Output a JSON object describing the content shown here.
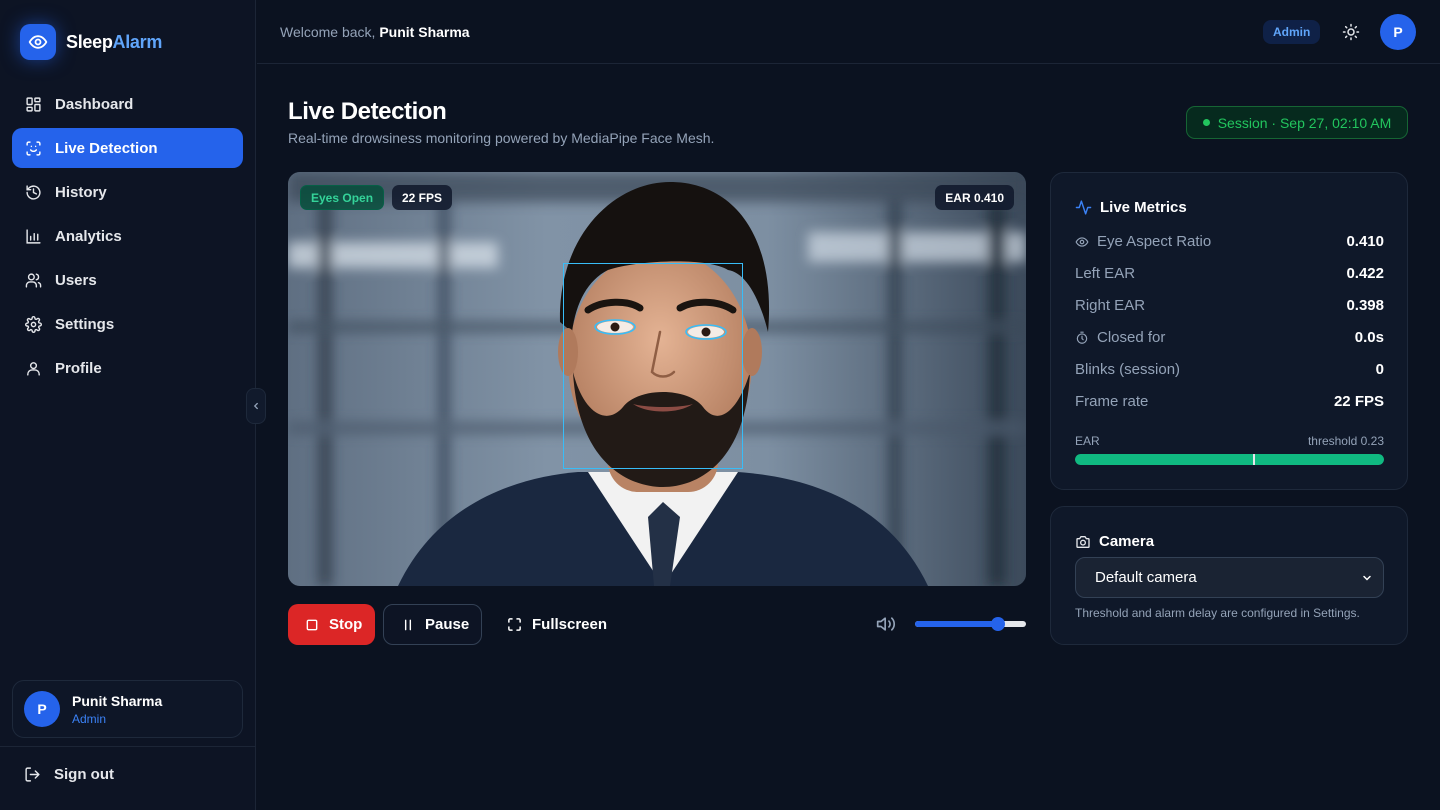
{
  "brand": {
    "name_part1": "Sleep",
    "name_part2": "Alarm"
  },
  "nav": [
    {
      "label": "Dashboard",
      "icon": "grid-icon"
    },
    {
      "label": "Live Detection",
      "icon": "scan-face-icon",
      "active": true
    },
    {
      "label": "History",
      "icon": "history-icon"
    },
    {
      "label": "Analytics",
      "icon": "bar-chart-icon"
    },
    {
      "label": "Users",
      "icon": "users-icon"
    },
    {
      "label": "Settings",
      "icon": "gear-icon"
    },
    {
      "label": "Profile",
      "icon": "user-icon"
    }
  ],
  "user": {
    "initial": "P",
    "name": "Punit Sharma",
    "role": "Admin"
  },
  "signout_label": "Sign out",
  "header": {
    "welcome_prefix": "Welcome back,",
    "welcome_name": "Punit Sharma",
    "role_badge": "Admin",
    "avatar_initial": "P"
  },
  "page": {
    "title": "Live Detection",
    "subtitle": "Real-time drowsiness monitoring powered by MediaPipe Face Mesh.",
    "session": "Session · Sep 27, 02:10 AM"
  },
  "video": {
    "eyes_tag": "Eyes Open",
    "fps_tag": "22 FPS",
    "ear_tag": "EAR 0.410"
  },
  "controls": {
    "stop_label": "Stop",
    "pause_label": "Pause",
    "fullscreen_label": "Fullscreen",
    "volume_level": 0.78
  },
  "metrics": {
    "title": "Live Metrics",
    "rows": [
      {
        "label": "Eye Aspect Ratio",
        "value": "0.410",
        "icon": "eye-icon"
      },
      {
        "label": "Left EAR",
        "value": "0.422"
      },
      {
        "label": "Right EAR",
        "value": "0.398"
      },
      {
        "label": "Closed for",
        "value": "0.0s",
        "icon": "timer-icon"
      },
      {
        "label": "Blinks (session)",
        "value": "0"
      },
      {
        "label": "Frame rate",
        "value": "22 FPS"
      }
    ],
    "ear_label": "EAR",
    "threshold_label": "threshold 0.23",
    "ear_fill": 1.0,
    "threshold_marker": 0.575
  },
  "camera": {
    "title": "Camera",
    "selected": "Default camera",
    "note": "Threshold and alarm delay are configured in Settings."
  },
  "colors": {
    "accent": "#2563eb",
    "success": "#10b981",
    "danger": "#dc2626"
  }
}
